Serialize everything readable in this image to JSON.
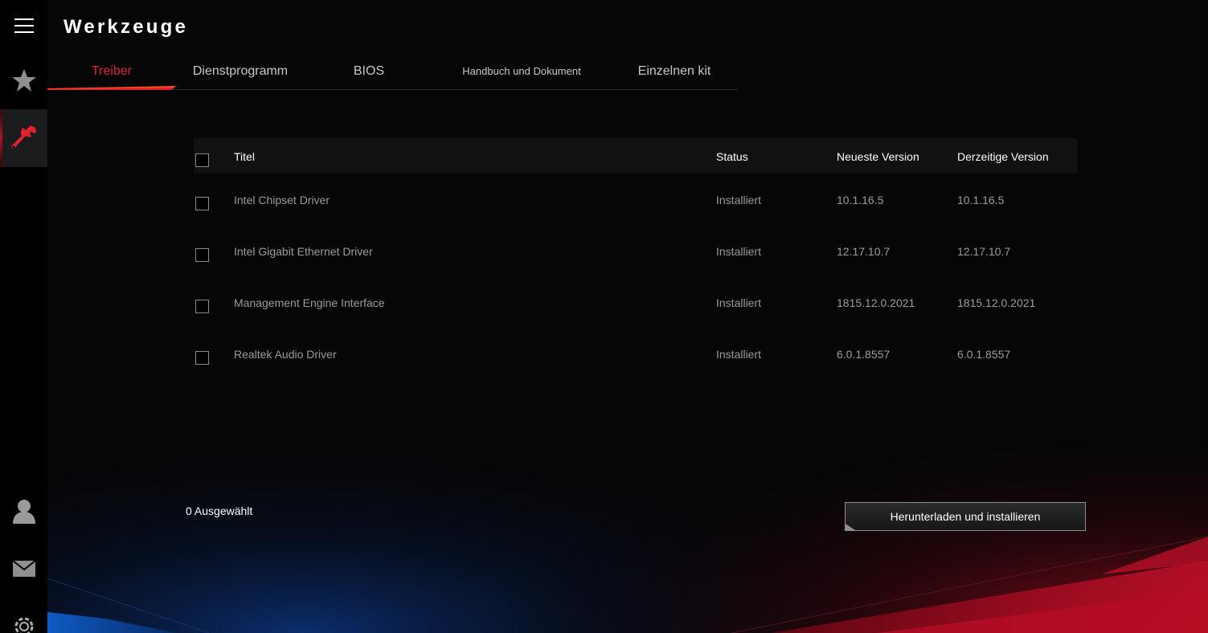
{
  "app": {
    "page_title": "Werkzeuge"
  },
  "sidebar": {
    "items": [
      {
        "name": "menu",
        "icon": "hamburger-menu-icon"
      },
      {
        "name": "favorites",
        "icon": "star-icon"
      },
      {
        "name": "tools",
        "icon": "wrench-icon",
        "active": true
      },
      {
        "name": "account",
        "icon": "user-icon"
      },
      {
        "name": "messages",
        "icon": "mail-icon"
      },
      {
        "name": "settings",
        "icon": "gear-icon"
      }
    ]
  },
  "tabs": [
    {
      "label": "Treiber",
      "active": true
    },
    {
      "label": "Dienstprogramm"
    },
    {
      "label": "BIOS"
    },
    {
      "label": "Handbuch und Dokument"
    },
    {
      "label": "Einzelnen kit"
    }
  ],
  "table": {
    "headers": {
      "title": "Titel",
      "status": "Status",
      "newest": "Neueste Version",
      "current": "Derzeitige Version"
    },
    "rows": [
      {
        "title": "Intel Chipset Driver",
        "status": "Installiert",
        "newest": "10.1.16.5",
        "current": "10.1.16.5",
        "checked": false
      },
      {
        "title": "Intel Gigabit Ethernet Driver",
        "status": "Installiert",
        "newest": "12.17.10.7",
        "current": "12.17.10.7",
        "checked": false
      },
      {
        "title": "Management Engine Interface",
        "status": "Installiert",
        "newest": "1815.12.0.2021",
        "current": "1815.12.0.2021",
        "checked": false
      },
      {
        "title": "Realtek Audio Driver",
        "status": "Installiert",
        "newest": "6.0.1.8557",
        "current": "6.0.1.8557",
        "checked": false
      }
    ]
  },
  "footer": {
    "selected_label": "0 Ausgewählt",
    "install_button": "Herunterladen und installieren"
  },
  "colors": {
    "accent": "#e0222f",
    "background": "#060607",
    "sidebar": "#000000",
    "active_sidebar": "#1c1c1e",
    "muted_text": "#9b9b9d"
  }
}
